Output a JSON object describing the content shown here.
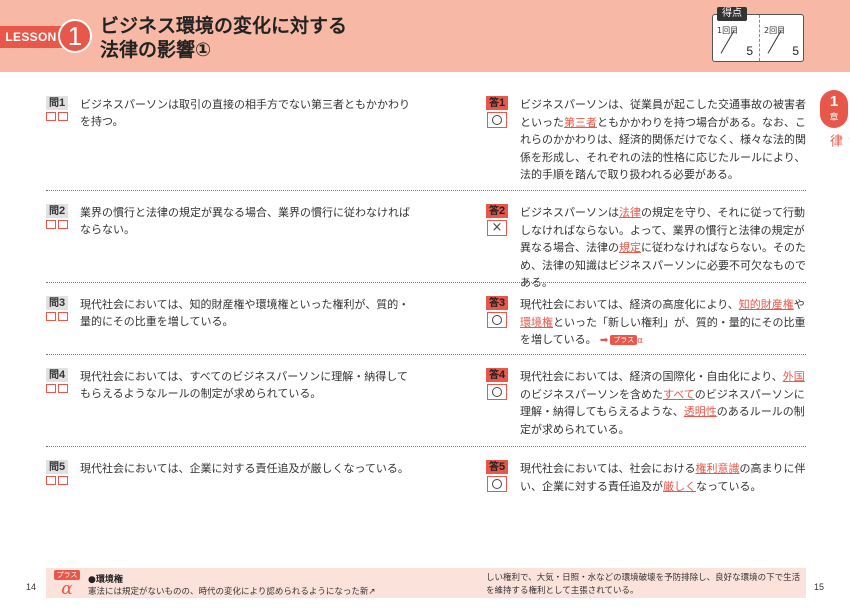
{
  "header": {
    "lesson_label": "LESSON",
    "lesson_number": "1",
    "title_line1": "ビジネス環境の変化に対する",
    "title_line2": "法律の影響①",
    "score": {
      "label": "得点",
      "attempt1_label": "1回目",
      "attempt2_label": "2回目",
      "total1": "5",
      "total2": "5"
    }
  },
  "chapter": {
    "number": "1",
    "suffix": "章",
    "title": "ビジネスにおけるリスクと法律"
  },
  "questions": [
    {
      "q_label": "問",
      "q_num": "1",
      "question": "ビジネスパーソンは取引の直接の相手方でない第三者ともかかわりを持つ。",
      "a_label": "答",
      "a_num": "1",
      "mark": "○",
      "answer_parts": [
        {
          "text": "ビジネスパーソンは、従業員が起こした交通事故の被害者といった"
        },
        {
          "text": "第三者",
          "hl": true
        },
        {
          "text": "ともかかわりを持つ場合がある。なお、これらのかかわりは、経済的関係だけでなく、様々な法的関係を形成し、それぞれの法的性格に応じたルールにより、法的手順を踏んで取り扱われる必要がある。"
        }
      ]
    },
    {
      "q_label": "問",
      "q_num": "2",
      "question": "業界の慣行と法律の規定が異なる場合、業界の慣行に従わなければならない。",
      "a_label": "答",
      "a_num": "2",
      "mark": "×",
      "answer_parts": [
        {
          "text": "ビジネスパーソンは"
        },
        {
          "text": "法律",
          "hl": true
        },
        {
          "text": "の規定を守り、それに従って行動しなければならない。よって、業界の慣行と法律の規定が異なる場合、法律の"
        },
        {
          "text": "規定",
          "hl": true
        },
        {
          "text": "に従わなければならない。そのため、法律の知識はビジネスパーソンに必要不可欠なものである。"
        }
      ]
    },
    {
      "q_label": "問",
      "q_num": "3",
      "question": "現代社会においては、知的財産権や環境権といった権利が、質的・量的にその比重を増している。",
      "a_label": "答",
      "a_num": "3",
      "mark": "○",
      "answer_parts": [
        {
          "text": "現代社会においては、経済の高度化により、"
        },
        {
          "text": "知的財産権",
          "hl": true
        },
        {
          "text": "や"
        },
        {
          "text": "環境権",
          "hl": true
        },
        {
          "text": "といった「新しい権利」が、質的・量的にその比重を増している。"
        }
      ],
      "plus_label": "プラス",
      "plus_symbol": "α"
    },
    {
      "q_label": "問",
      "q_num": "4",
      "question": "現代社会においては、すべてのビジネスパーソンに理解・納得してもらえるようなルールの制定が求められている。",
      "a_label": "答",
      "a_num": "4",
      "mark": "○",
      "answer_parts": [
        {
          "text": "現代社会においては、経済の国際化・自由化により、"
        },
        {
          "text": "外国",
          "hl": true
        },
        {
          "text": "のビジネスパーソンを含めた"
        },
        {
          "text": "すべて",
          "hl": true
        },
        {
          "text": "のビジネスパーソンに理解・納得してもらえるような、"
        },
        {
          "text": "透明性",
          "hl": true
        },
        {
          "text": "のあるルールの制定が求められている。"
        }
      ]
    },
    {
      "q_label": "問",
      "q_num": "5",
      "question": "現代社会においては、企業に対する責任追及が厳しくなっている。",
      "a_label": "答",
      "a_num": "5",
      "mark": "○",
      "answer_parts": [
        {
          "text": "現代社会においては、社会における"
        },
        {
          "text": "権利意識",
          "hl": true
        },
        {
          "text": "の高まりに伴い、企業に対する責任追及が"
        },
        {
          "text": "厳しく",
          "hl": true
        },
        {
          "text": "なっている。"
        }
      ]
    }
  ],
  "footer": {
    "plus_label": "プラス",
    "plus_symbol": "α",
    "term": "●環境権",
    "left_text": "憲法には規定がないものの、時代の変化により認められるようになった新↗",
    "right_text": "しい権利で、大気・日照・水などの環境破壊を予防排除し、良好な環境の下で生活を維持する権利として主張されている。",
    "page_left": "14",
    "page_right": "15"
  }
}
